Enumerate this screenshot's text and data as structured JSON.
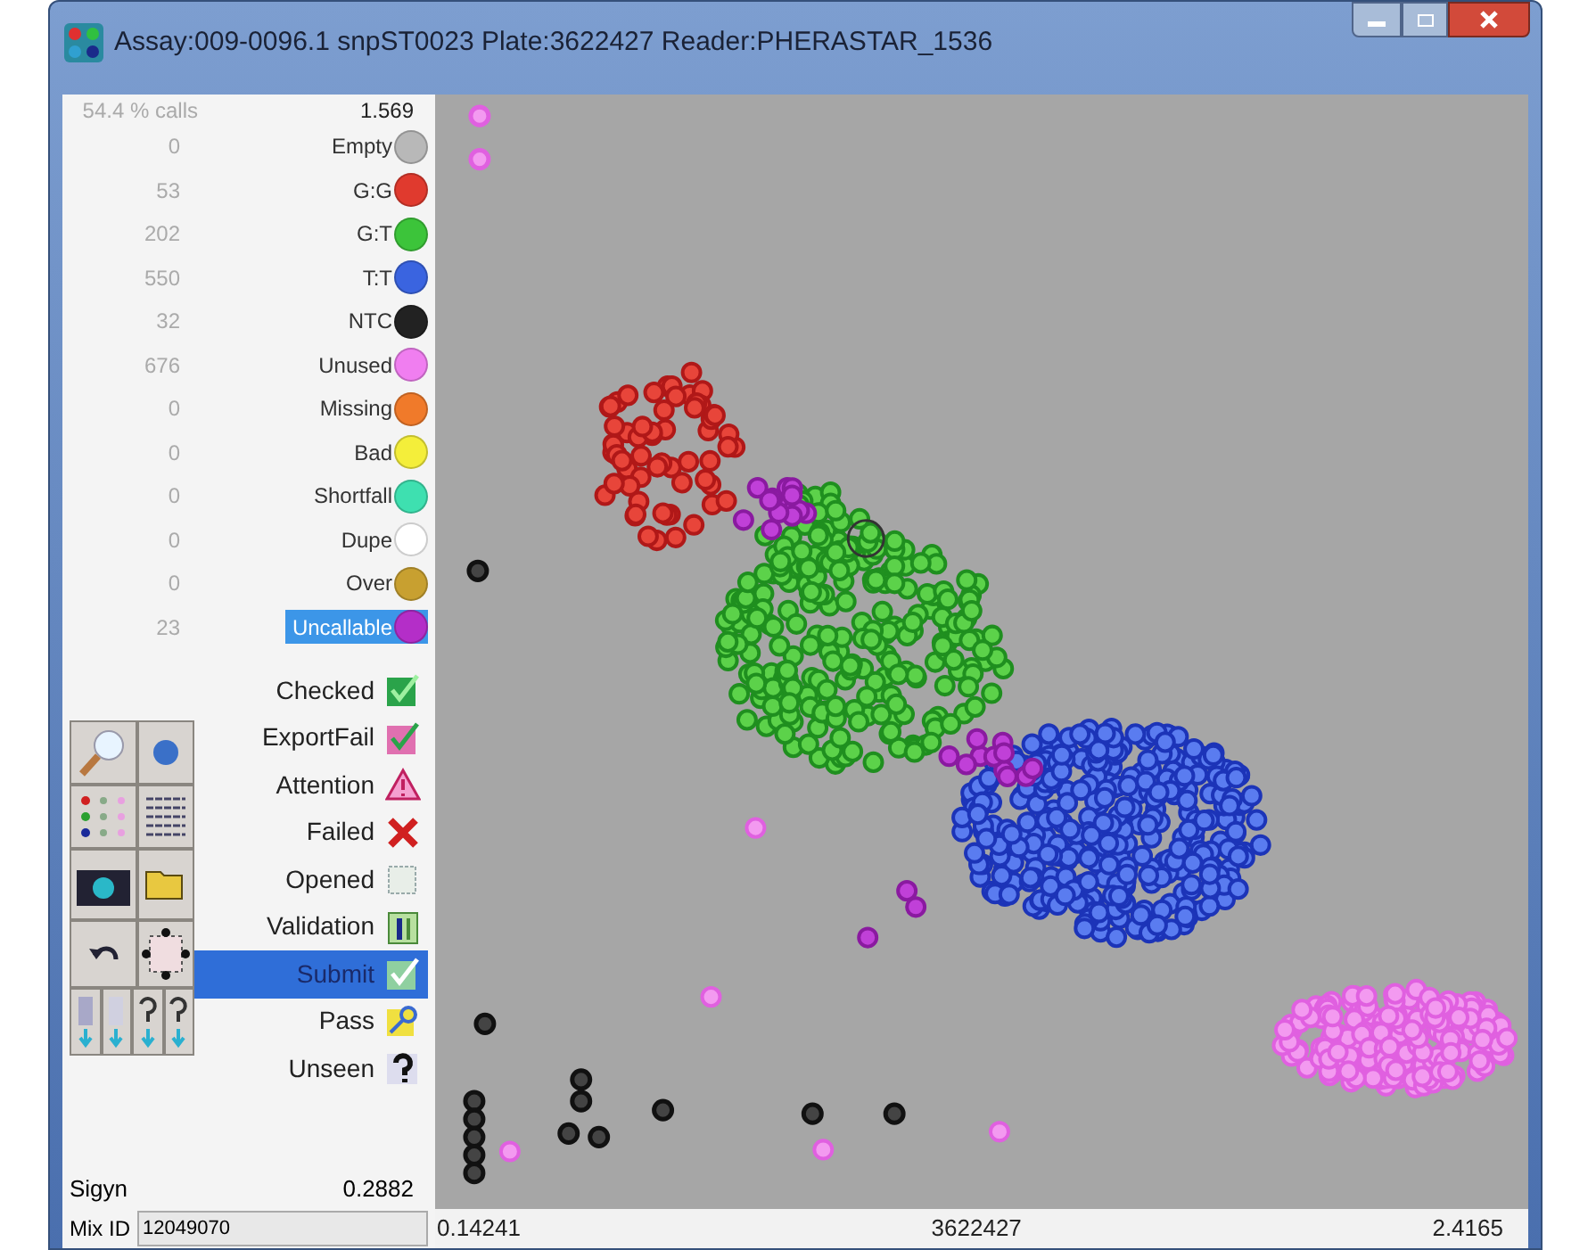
{
  "window": {
    "title": "Assay:009-0096.1 snpST0023  Plate:3622427  Reader:PHERASTAR_1536"
  },
  "summary": {
    "calls": "54.4 % calls",
    "value": "1.569"
  },
  "legend": [
    {
      "count": "0",
      "label": "Empty",
      "color": "#b8b8b8",
      "selected": false
    },
    {
      "count": "53",
      "label": "G:G",
      "color": "#e03a2e",
      "selected": false
    },
    {
      "count": "202",
      "label": "G:T",
      "color": "#3cc43a",
      "selected": false
    },
    {
      "count": "550",
      "label": "T:T",
      "color": "#3a64e0",
      "selected": false
    },
    {
      "count": "32",
      "label": "NTC",
      "color": "#222222",
      "selected": false
    },
    {
      "count": "676",
      "label": "Unused",
      "color": "#f07ef0",
      "selected": false
    },
    {
      "count": "0",
      "label": "Missing",
      "color": "#f07a2a",
      "selected": false
    },
    {
      "count": "0",
      "label": "Bad",
      "color": "#f4ee3a",
      "selected": false
    },
    {
      "count": "0",
      "label": "Shortfall",
      "color": "#3ee0b0",
      "selected": false
    },
    {
      "count": "0",
      "label": "Dupe",
      "color": "#ffffff",
      "selected": false
    },
    {
      "count": "0",
      "label": "Over",
      "color": "#c8a030",
      "selected": false
    },
    {
      "count": "23",
      "label": "Uncallable",
      "color": "#b42ec8",
      "selected": true
    }
  ],
  "statuses": [
    {
      "label": "Checked",
      "kind": "checked",
      "selected": false
    },
    {
      "label": "ExportFail",
      "kind": "exportfail",
      "selected": false
    },
    {
      "label": "Attention",
      "kind": "attention",
      "selected": false
    },
    {
      "label": "Failed",
      "kind": "failed",
      "selected": false
    },
    {
      "label": "Opened",
      "kind": "opened",
      "selected": false
    },
    {
      "label": "Validation",
      "kind": "validation",
      "selected": false
    },
    {
      "label": "Submit",
      "kind": "submit",
      "selected": true
    },
    {
      "label": "Pass",
      "kind": "pass",
      "selected": false
    },
    {
      "label": "Unseen",
      "kind": "unseen",
      "selected": false
    }
  ],
  "sigyn": {
    "label": "Sigyn",
    "value": "0.2882"
  },
  "mix_id": {
    "label": "Mix ID",
    "value": "12049070"
  },
  "axis": {
    "min": "0.14241",
    "plate": "3622427",
    "max": "2.4165"
  }
}
